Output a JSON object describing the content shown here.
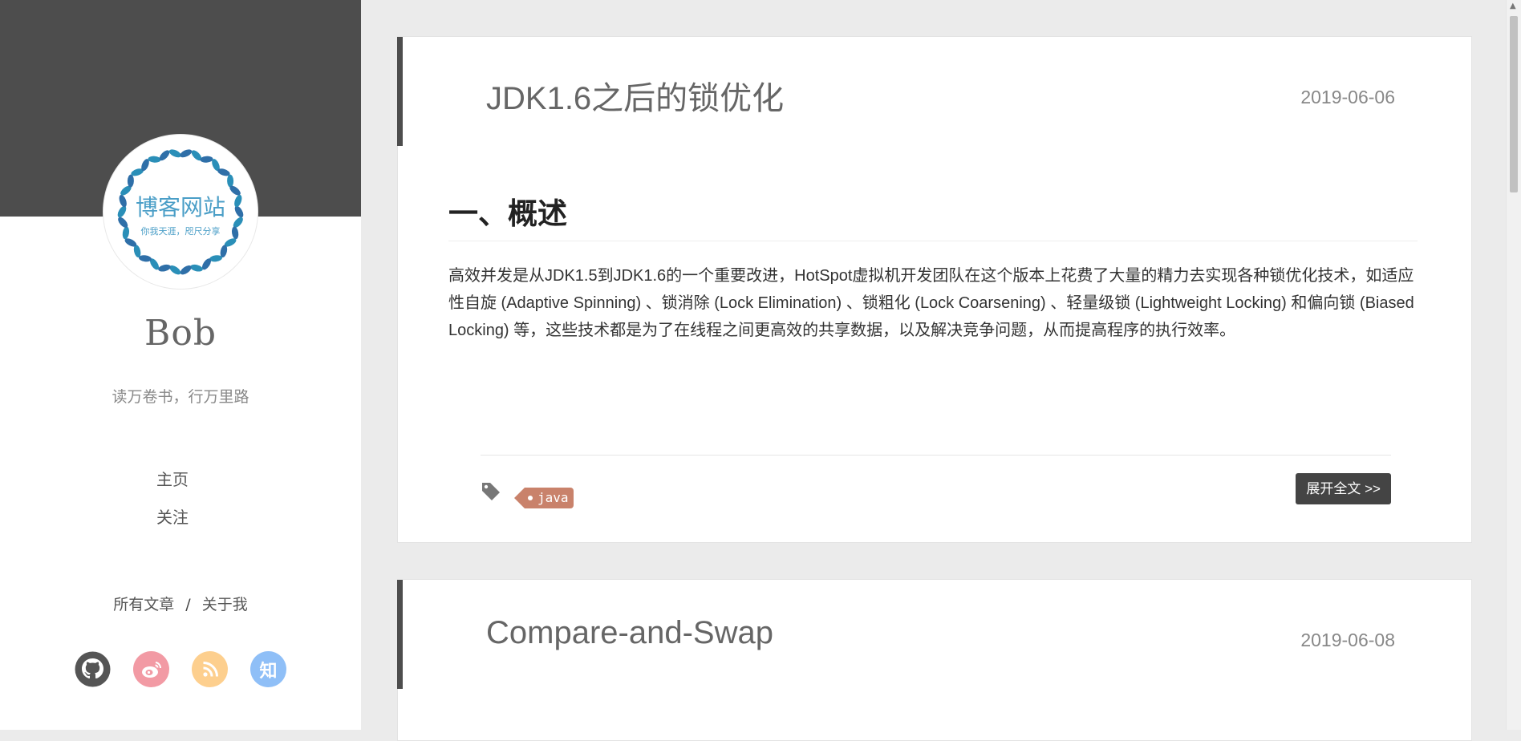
{
  "sidebar": {
    "avatar_text": "博客网站",
    "avatar_subtext": "你我天涯，咫尺分享",
    "author_name": "Bob",
    "motto": "读万卷书，行万里路",
    "nav": [
      {
        "label": "主页"
      },
      {
        "label": "关注"
      }
    ],
    "links": {
      "all_posts": "所有文章",
      "separator": "/",
      "about": "关于我"
    },
    "social": [
      {
        "icon": "github-icon"
      },
      {
        "icon": "weibo-icon"
      },
      {
        "icon": "rss-icon"
      },
      {
        "icon": "zhihu-icon",
        "glyph": "知"
      }
    ]
  },
  "posts": [
    {
      "title": "JDK1.6之后的锁优化",
      "date": "2019-06-06",
      "heading": "一、概述",
      "paragraph": "高效并发是从JDK1.5到JDK1.6的一个重要改进，HotSpot虚拟机开发团队在这个版本上花费了大量的精力去实现各种锁优化技术，如适应性自旋 (Adaptive Spinning) 、锁消除 (Lock Elimination) 、锁粗化 (Lock Coarsening) 、轻量级锁 (Lightweight Locking) 和偏向锁 (Biased Locking) 等，这些技术都是为了在线程之间更高效的共享数据，以及解决竞争问题，从而提高程序的执行效率。",
      "tag": "java",
      "expand_label": "展开全文 >>"
    },
    {
      "title": "Compare-and-Swap",
      "date": "2019-06-08"
    }
  ],
  "colors": {
    "sidebar_banner": "#4d4d4d",
    "tag": "#c9826b",
    "button": "#444444",
    "background": "#ebebeb"
  }
}
